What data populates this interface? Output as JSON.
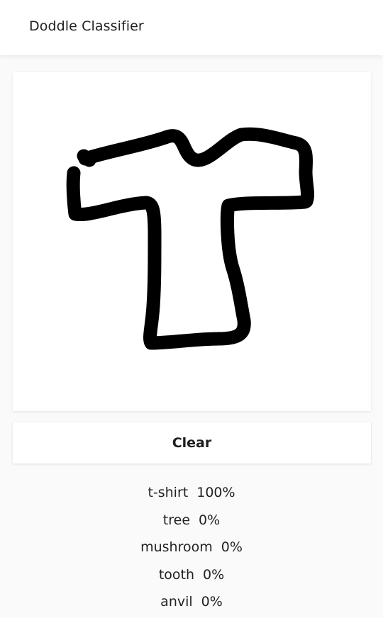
{
  "header": {
    "title": "Doddle Classifier"
  },
  "canvas": {
    "stroke_color": "#000000",
    "background": "#ffffff"
  },
  "actions": {
    "clear_label": "Clear"
  },
  "predictions": [
    {
      "label": "t-shirt",
      "percent": "100%"
    },
    {
      "label": "tree",
      "percent": "0%"
    },
    {
      "label": "mushroom",
      "percent": "0%"
    },
    {
      "label": "tooth",
      "percent": "0%"
    },
    {
      "label": "anvil",
      "percent": "0%"
    }
  ]
}
